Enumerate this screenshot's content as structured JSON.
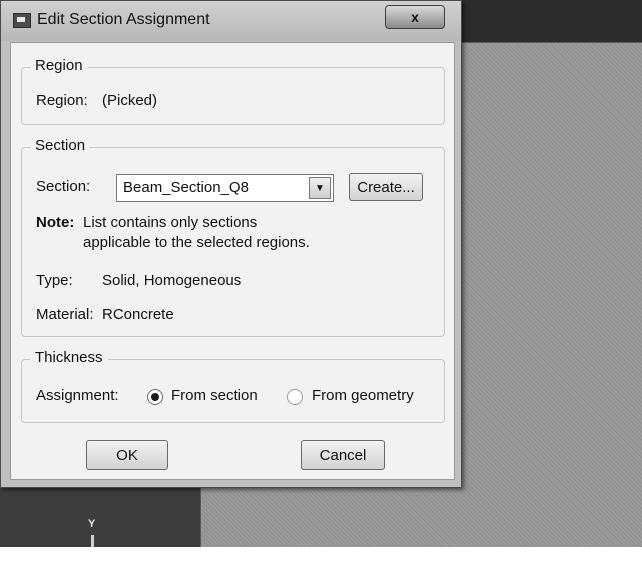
{
  "dialog": {
    "title": "Edit Section Assignment",
    "close_label": "x"
  },
  "region": {
    "group_title": "Region",
    "label": "Region:",
    "value": "(Picked)"
  },
  "section": {
    "group_title": "Section",
    "label": "Section:",
    "selected": "Beam_Section_Q8",
    "create_label": "Create...",
    "note_label": "Note:",
    "note_line1": "List contains only sections",
    "note_line2": "applicable to the selected regions.",
    "type_label": "Type:",
    "type_value": "Solid, Homogeneous",
    "material_label": "Material:",
    "material_value": "RConcrete"
  },
  "thickness": {
    "group_title": "Thickness",
    "assignment_label": "Assignment:",
    "option_section": "From section",
    "option_geometry": "From geometry",
    "selected": "From section"
  },
  "buttons": {
    "ok": "OK",
    "cancel": "Cancel"
  },
  "viewport": {
    "triad_label": "Y"
  }
}
